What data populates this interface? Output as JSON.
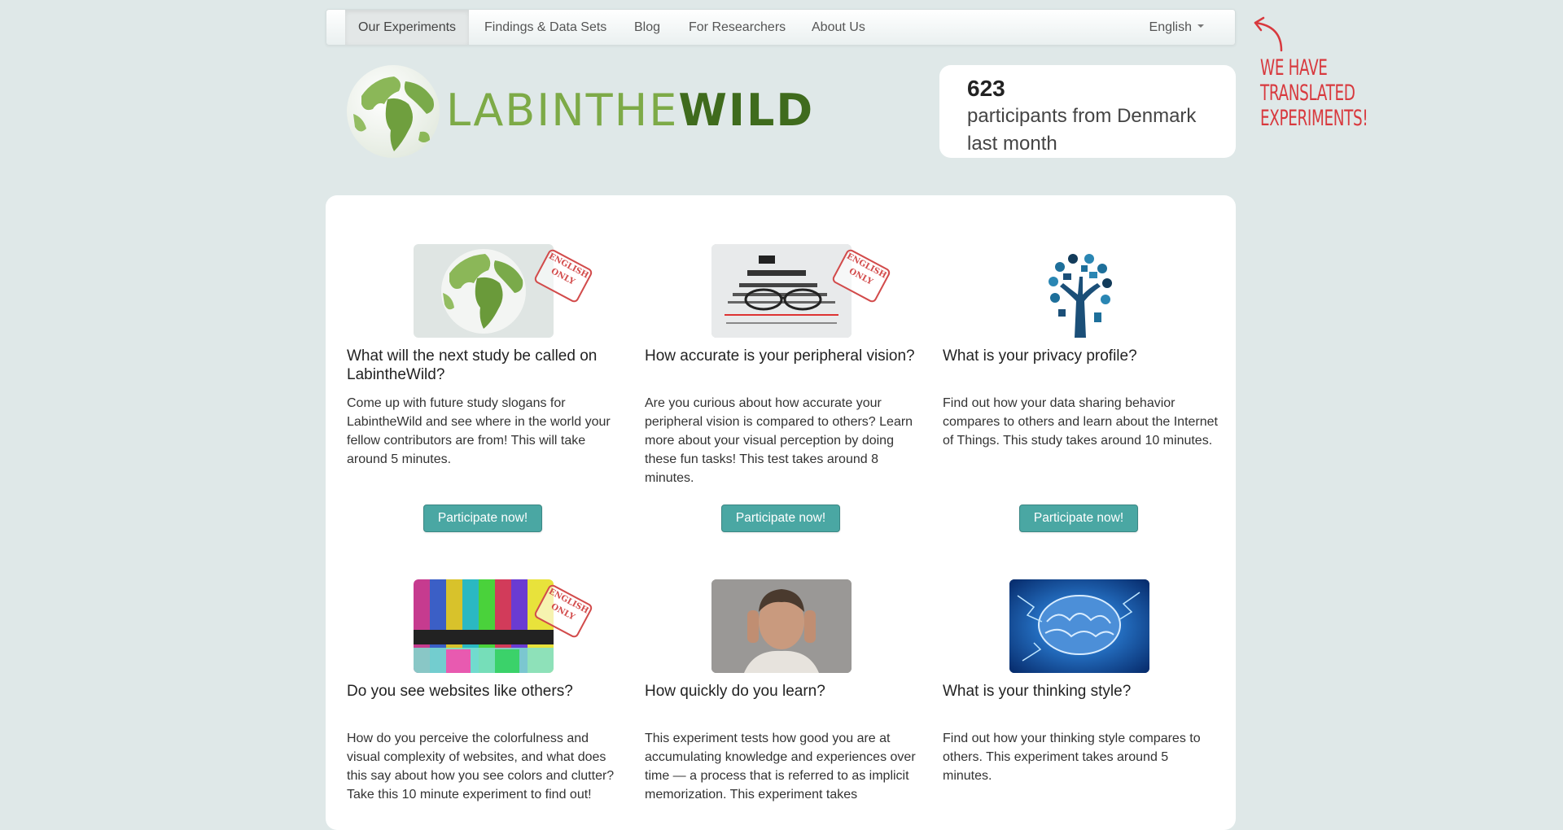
{
  "nav": {
    "items": [
      {
        "label": "Our Experiments",
        "active": true
      },
      {
        "label": "Findings & Data Sets"
      },
      {
        "label": "Blog"
      },
      {
        "label": "For Researchers"
      },
      {
        "label": "About Us"
      }
    ],
    "language": "English"
  },
  "logo": {
    "lab": "LABINTHE",
    "wild": "WILD"
  },
  "stats": {
    "count": "623",
    "text": "participants from Denmark last month"
  },
  "annotation": {
    "lines": [
      "WE HAVE",
      "TRANSLATED",
      "EXPERIMENTS!"
    ],
    "arrow_icon": "curved-arrow-icon"
  },
  "stamp_text": "ENGLISH ONLY",
  "experiments": [
    {
      "title": "What will the next study be called on LabintheWild?",
      "description": "Come up with future study slogans for LabintheWild and see where in the world your fellow contributors are from! This will take around 5 minutes.",
      "button": "Participate now!",
      "image": "globe-image",
      "english_only": true
    },
    {
      "title": "How accurate is your peripheral vision?",
      "description": "Are you curious about how accurate your peripheral vision is compared to others? Learn more about your visual perception by doing these fun tasks! This test takes around 8 minutes.",
      "button": "Participate now!",
      "image": "eye-chart-image",
      "english_only": true
    },
    {
      "title": "What is your privacy profile?",
      "description": "Find out how your data sharing behavior compares to others and learn about the Internet of Things. This study takes around 10 minutes.",
      "button": "Participate now!",
      "image": "privacy-tree-image",
      "english_only": false
    },
    {
      "title": "Do you see websites like others?",
      "description": "How do you perceive the colorfulness and visual complexity of websites, and what does this say about how you see colors and clutter? Take this 10 minute experiment to find out!",
      "image": "tv-test-pattern-image",
      "english_only": true
    },
    {
      "title": "How quickly do you learn?",
      "description": "This experiment tests how good you are at accumulating knowledge and experiences over time — a process that is referred to as implicit memorization. This experiment takes",
      "image": "thinking-man-image",
      "english_only": false
    },
    {
      "title": "What is your thinking style?",
      "description": "Find out how your thinking style compares to others. This experiment takes around 5 minutes.",
      "image": "brain-image",
      "english_only": false
    }
  ]
}
